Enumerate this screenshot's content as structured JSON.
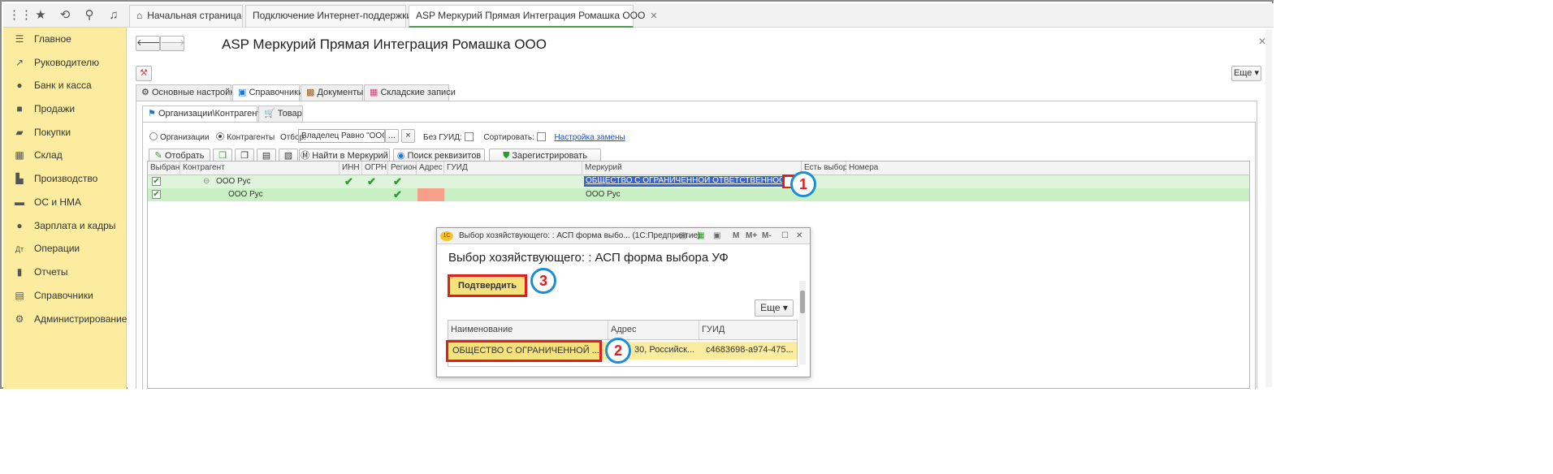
{
  "tabs": [
    {
      "label": "Начальная страница"
    },
    {
      "label": "Подключение Интернет-поддержки"
    },
    {
      "label": "ASP Меркурий Прямая Интеграция Ромашка ООО"
    }
  ],
  "sidebar": {
    "items": [
      {
        "label": "Главное",
        "icon": "menu-icon"
      },
      {
        "label": "Руководителю",
        "icon": "chart-trend-icon"
      },
      {
        "label": "Банк и касса",
        "icon": "ruble-coin-icon"
      },
      {
        "label": "Продажи",
        "icon": "shopping-bag-icon"
      },
      {
        "label": "Покупки",
        "icon": "cart-icon"
      },
      {
        "label": "Склад",
        "icon": "warehouse-grid-icon"
      },
      {
        "label": "Производство",
        "icon": "factory-icon"
      },
      {
        "label": "ОС и НМА",
        "icon": "truck-icon"
      },
      {
        "label": "Зарплата и кадры",
        "icon": "person-icon"
      },
      {
        "label": "Операции",
        "icon": "debit-credit-icon"
      },
      {
        "label": "Отчеты",
        "icon": "bar-chart-icon"
      },
      {
        "label": "Справочники",
        "icon": "book-icon"
      },
      {
        "label": "Администрирование",
        "icon": "gear-icon"
      }
    ]
  },
  "page": {
    "title": "ASP Меркурий Прямая Интеграция Ромашка ООО",
    "more_button": "Еще"
  },
  "main_tabs": [
    {
      "label": "Основные настройки"
    },
    {
      "label": "Справочники"
    },
    {
      "label": "Документы"
    },
    {
      "label": "Складские записи"
    }
  ],
  "sub_tabs": [
    {
      "label": "Организации\\Контрагенты"
    },
    {
      "label": "Товар"
    }
  ],
  "filter": {
    "radio_org": "Организации",
    "radio_contr": "Контрагенты",
    "otbor_label": "Отбор:",
    "otbor_value": "Владелец Равно \"ООО Р",
    "ellipsis": "...",
    "clear": "×",
    "no_guid": "Без ГУИД:",
    "sort": "Сортировать:",
    "settings_link": "Настройка замены"
  },
  "toolbar": {
    "select": "Отобрать",
    "find_mercury": "Найти в Меркурий",
    "find_details": "Поиск реквизитов",
    "register": "Зарегистрировать"
  },
  "grid": {
    "headers": [
      "Выбран",
      "Контрагент",
      "ИНН",
      "ОГРН",
      "Регион",
      "Адрес",
      "ГУИД",
      "Меркурий",
      "Есть выбор",
      "Номера"
    ],
    "rows": [
      {
        "contragent": "ООО Рус",
        "mercury": "ОБЩЕСТВО С ОГРАНИЧЕННОЙ ОТВЕТСТВЕННОСТЬЮ \"Р"
      },
      {
        "contragent": "ООО Рус",
        "mercury": "ООО Рус"
      }
    ]
  },
  "dialog": {
    "titlebar": "Выбор хозяйствующего: : АСП форма выбо...  (1С:Предприятие)",
    "heading": "Выбор хозяйствующего: : АСП форма выбора УФ",
    "confirm_button": "Подтвердить",
    "more_button": "Еще",
    "toolbar_m": "M",
    "toolbar_mplus": "M+",
    "toolbar_mminus": "M-",
    "headers": [
      "Наименование",
      "Адрес",
      "ГУИД"
    ],
    "row": {
      "name": "ОБЩЕСТВО С ОГРАНИЧЕННОЙ ...",
      "address": "30, Российск...",
      "guid": "c4683698-a974-475..."
    }
  },
  "callouts": [
    "1",
    "2",
    "3"
  ],
  "colors": {
    "sidebar_bg": "#fbeca0",
    "row_green": "#c9f0c5",
    "selection_blue": "#3a64c8",
    "callout_red": "#e02020",
    "callout_ring": "#1a8fd8",
    "highlight_box": "#e01e1e",
    "address_pink": "#f6a08a"
  }
}
